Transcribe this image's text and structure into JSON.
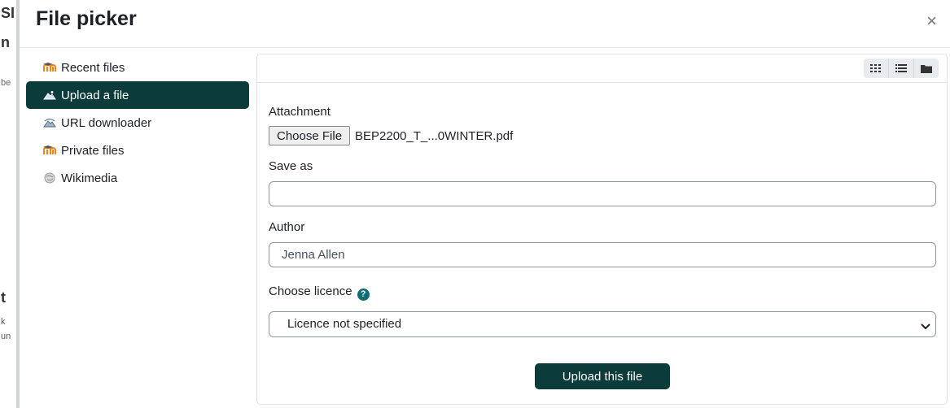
{
  "dialog": {
    "title": "File picker",
    "close_glyph": "×"
  },
  "backdrop": {
    "frag1": "SI",
    "frag2": "n",
    "frag3": "be",
    "frag4": "t",
    "frag5": "k",
    "frag6": "un"
  },
  "sidebar": {
    "items": [
      {
        "label": "Recent files",
        "icon": "moodle-icon",
        "active": false
      },
      {
        "label": "Upload a file",
        "icon": "upload-icon",
        "active": true
      },
      {
        "label": "URL downloader",
        "icon": "url-downloader-icon",
        "active": false
      },
      {
        "label": "Private files",
        "icon": "moodle-icon",
        "active": false
      },
      {
        "label": "Wikimedia",
        "icon": "wikimedia-icon",
        "active": false
      }
    ]
  },
  "view_modes": [
    "icons-view-icon",
    "list-view-icon",
    "tree-view-icon"
  ],
  "form": {
    "attachment_label": "Attachment",
    "choose_file_label": "Choose File",
    "file_name": "BEP2200_T_...0WINTER.pdf",
    "save_as_label": "Save as",
    "save_as_value": "",
    "author_label": "Author",
    "author_value": "Jenna Allen",
    "licence_label": "Choose licence",
    "licence_value": "Licence not specified",
    "upload_button": "Upload this file"
  },
  "colors": {
    "accent": "#0b3b3a",
    "help_icon": "#0f6e72",
    "moodle_orange": "#f98012"
  }
}
